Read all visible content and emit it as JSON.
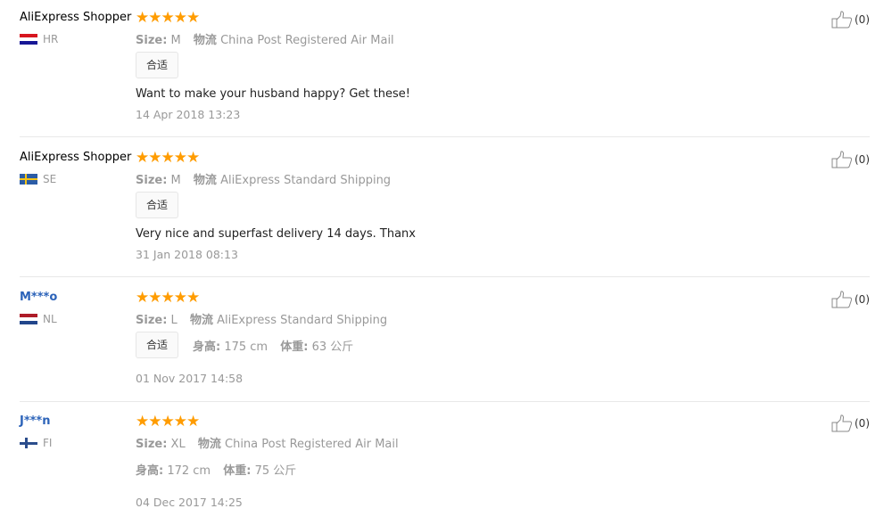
{
  "labels": {
    "size": "Size:",
    "shipping": "物流",
    "height": "身高:",
    "weight": "体重:"
  },
  "star_glyph": "★★★★★",
  "colors": {
    "star": "#ff9c00",
    "username_link": "#2c63b9",
    "meta": "#999999"
  },
  "reviews": [
    {
      "user": "AliExpress Shopper",
      "country": "HR",
      "flag": "croatia-flag",
      "rating": 5,
      "size": "M",
      "shipping": "China Post Registered Air Mail",
      "tag": "合适",
      "text": "Want to make your husband happy? Get these!",
      "date": "14 Apr 2018 13:23",
      "helpful": "(0)"
    },
    {
      "user": "AliExpress Shopper",
      "country": "SE",
      "flag": "sweden-flag",
      "rating": 5,
      "size": "M",
      "shipping": "AliExpress Standard Shipping",
      "tag": "合适",
      "text": "Very nice and superfast delivery 14 days. Thanx",
      "date": "31 Jan 2018 08:13",
      "helpful": "(0)"
    },
    {
      "user": "M***o",
      "country": "NL",
      "flag": "netherlands-flag",
      "rating": 5,
      "size": "L",
      "shipping": "AliExpress Standard Shipping",
      "tag": "合适",
      "height": "175 cm",
      "weight": "63 公斤",
      "date": "01 Nov 2017 14:58",
      "helpful": "(0)"
    },
    {
      "user": "J***n",
      "country": "FI",
      "flag": "finland-flag",
      "rating": 5,
      "size": "XL",
      "shipping": "China Post Registered Air Mail",
      "height": "172 cm",
      "weight": "75 公斤",
      "date": "04 Dec 2017 14:25",
      "helpful": "(0)"
    }
  ]
}
